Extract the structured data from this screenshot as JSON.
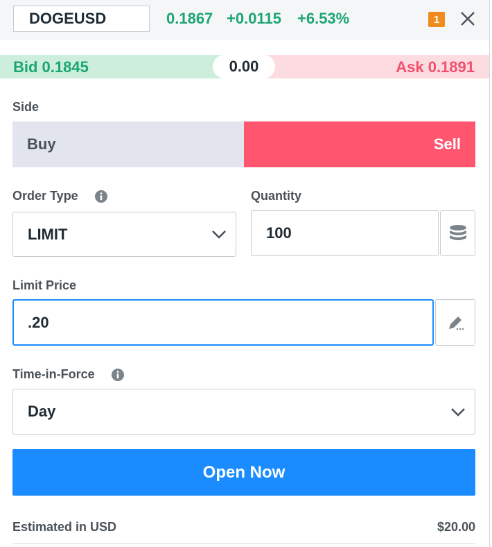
{
  "header": {
    "symbol": "DOGEUSD",
    "last_price": "0.1867",
    "change": "+0.0115",
    "change_pct": "+6.53%",
    "notification_count": "1",
    "close_icon": "close-icon"
  },
  "quote_bar": {
    "bid": "Bid 0.1845",
    "spread": "0.00",
    "ask": "Ask 0.1891"
  },
  "side": {
    "label": "Side",
    "buy_label": "Buy",
    "sell_label": "Sell",
    "selected": "Sell"
  },
  "order_type": {
    "label": "Order Type",
    "value": "LIMIT",
    "info_icon": "info-icon"
  },
  "quantity": {
    "label": "Quantity",
    "value": "100",
    "units_icon": "coin-stack-icon"
  },
  "limit_price": {
    "label": "Limit Price",
    "value": ".20",
    "edit_icon": "pencil-icon"
  },
  "time_in_force": {
    "label": "Time-in-Force",
    "value": "Day",
    "info_icon": "info-icon"
  },
  "submit": {
    "label": "Open Now"
  },
  "estimate": {
    "label": "Estimated in USD",
    "value": "$20.00"
  },
  "colors": {
    "positive": "#1ba672",
    "negative": "#f0506e",
    "sell": "#ff5670",
    "primary": "#1a8cff",
    "badge": "#f08b1f"
  }
}
